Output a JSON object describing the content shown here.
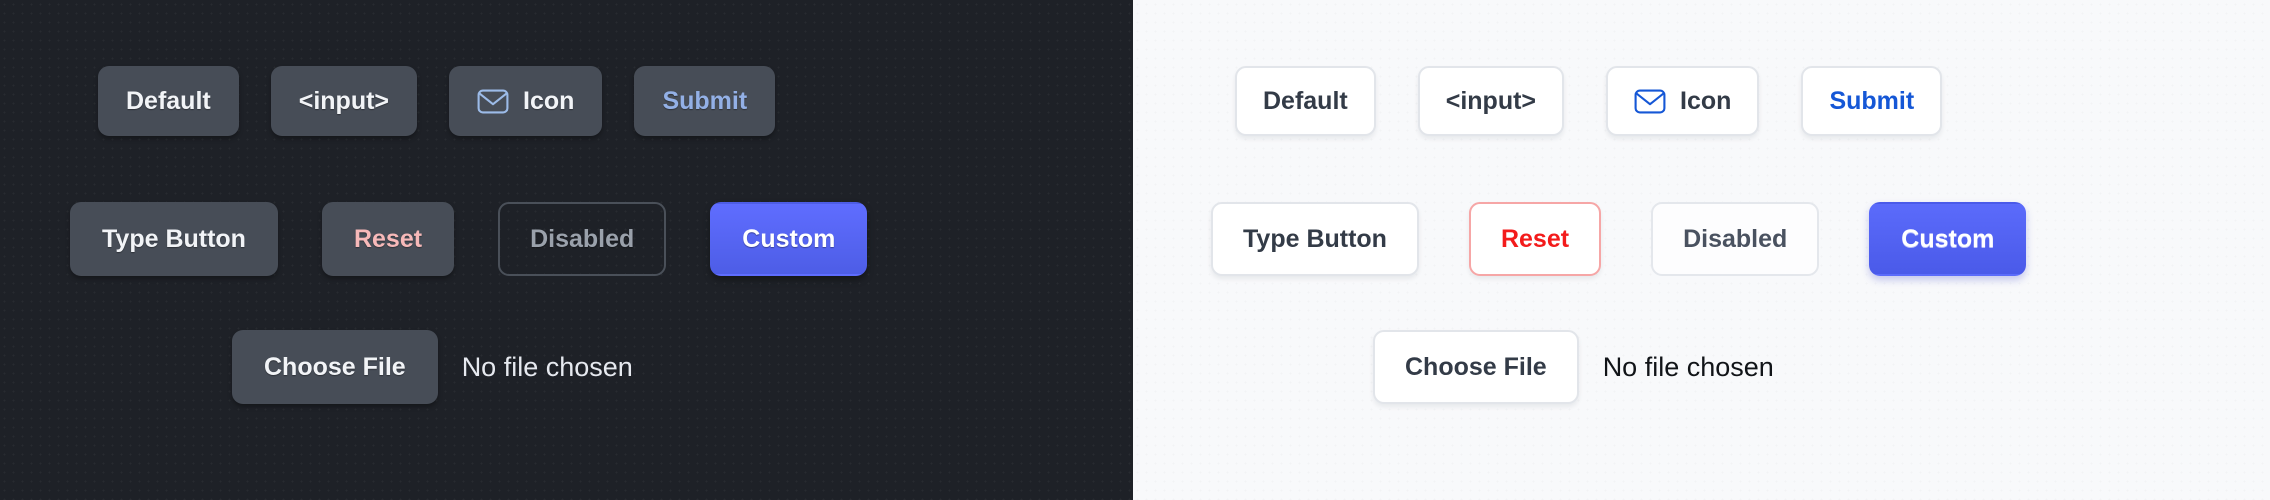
{
  "panels": {
    "dark": {
      "theme_label": "dark",
      "bg": "#1e2127",
      "row1": [
        {
          "label": "Default",
          "variant": "default"
        },
        {
          "label": "<input>",
          "variant": "default"
        },
        {
          "label": "Icon",
          "variant": "icon",
          "icon": "envelope-icon"
        },
        {
          "label": "Submit",
          "variant": "accent"
        }
      ],
      "row2": [
        {
          "label": "Type Button",
          "variant": "default"
        },
        {
          "label": "Reset",
          "variant": "danger"
        },
        {
          "label": "Disabled",
          "variant": "disabled"
        },
        {
          "label": "Custom",
          "variant": "custom"
        }
      ],
      "file": {
        "button_label": "Choose File",
        "status": "No file chosen"
      },
      "colors": {
        "surface": "#474d57",
        "text": "#f2f4f7",
        "accent": "#93b0e6",
        "danger": "#f7b9b9",
        "disabled_text": "#9aa1ab",
        "disabled_border": "#4a5059",
        "custom_from": "#5f6dff",
        "custom_to": "#4d5de6",
        "icon": "#9cbbe8"
      }
    },
    "light": {
      "theme_label": "light",
      "bg": "#f8f9fb",
      "row1": [
        {
          "label": "Default",
          "variant": "default"
        },
        {
          "label": "<input>",
          "variant": "default"
        },
        {
          "label": "Icon",
          "variant": "icon",
          "icon": "envelope-icon"
        },
        {
          "label": "Submit",
          "variant": "accent"
        }
      ],
      "row2": [
        {
          "label": "Type Button",
          "variant": "default"
        },
        {
          "label": "Reset",
          "variant": "danger"
        },
        {
          "label": "Disabled",
          "variant": "disabled"
        },
        {
          "label": "Custom",
          "variant": "custom"
        }
      ],
      "file": {
        "button_label": "Choose File",
        "status": "No file chosen"
      },
      "colors": {
        "surface": "#ffffff",
        "text": "#333b47",
        "border": "#e2e5ea",
        "accent": "#1557d6",
        "danger": "#f31b1b",
        "danger_border": "#f6a6a6",
        "disabled_text": "#4a5260",
        "custom_from": "#5b6bfb",
        "custom_to": "#4a5ae9",
        "icon": "#1557d6"
      }
    }
  }
}
